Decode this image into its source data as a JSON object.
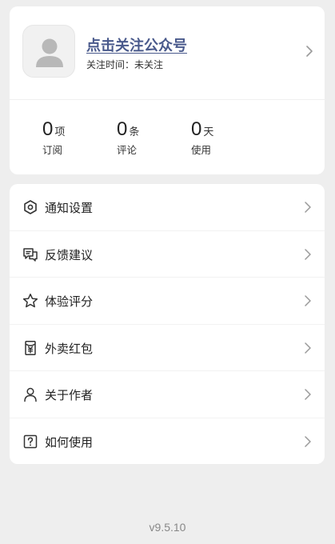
{
  "profile": {
    "name": "点击关注公众号",
    "follow_label": "关注时间：",
    "follow_value": "未关注"
  },
  "stats": [
    {
      "value": "0",
      "unit": "项",
      "label": "订阅"
    },
    {
      "value": "0",
      "unit": "条",
      "label": "评论"
    },
    {
      "value": "0",
      "unit": "天",
      "label": "使用"
    }
  ],
  "menu": [
    {
      "label": "通知设置",
      "icon": "hexagon-settings-icon"
    },
    {
      "label": "反馈建议",
      "icon": "feedback-chat-icon"
    },
    {
      "label": "体验评分",
      "icon": "star-icon"
    },
    {
      "label": "外卖红包",
      "icon": "red-packet-icon"
    },
    {
      "label": "关于作者",
      "icon": "person-icon"
    },
    {
      "label": "如何使用",
      "icon": "question-box-icon"
    }
  ],
  "version": "v9.5.10",
  "colors": {
    "background": "#eeeeee",
    "card": "#ffffff",
    "profile_link": "#4a5a8c"
  }
}
